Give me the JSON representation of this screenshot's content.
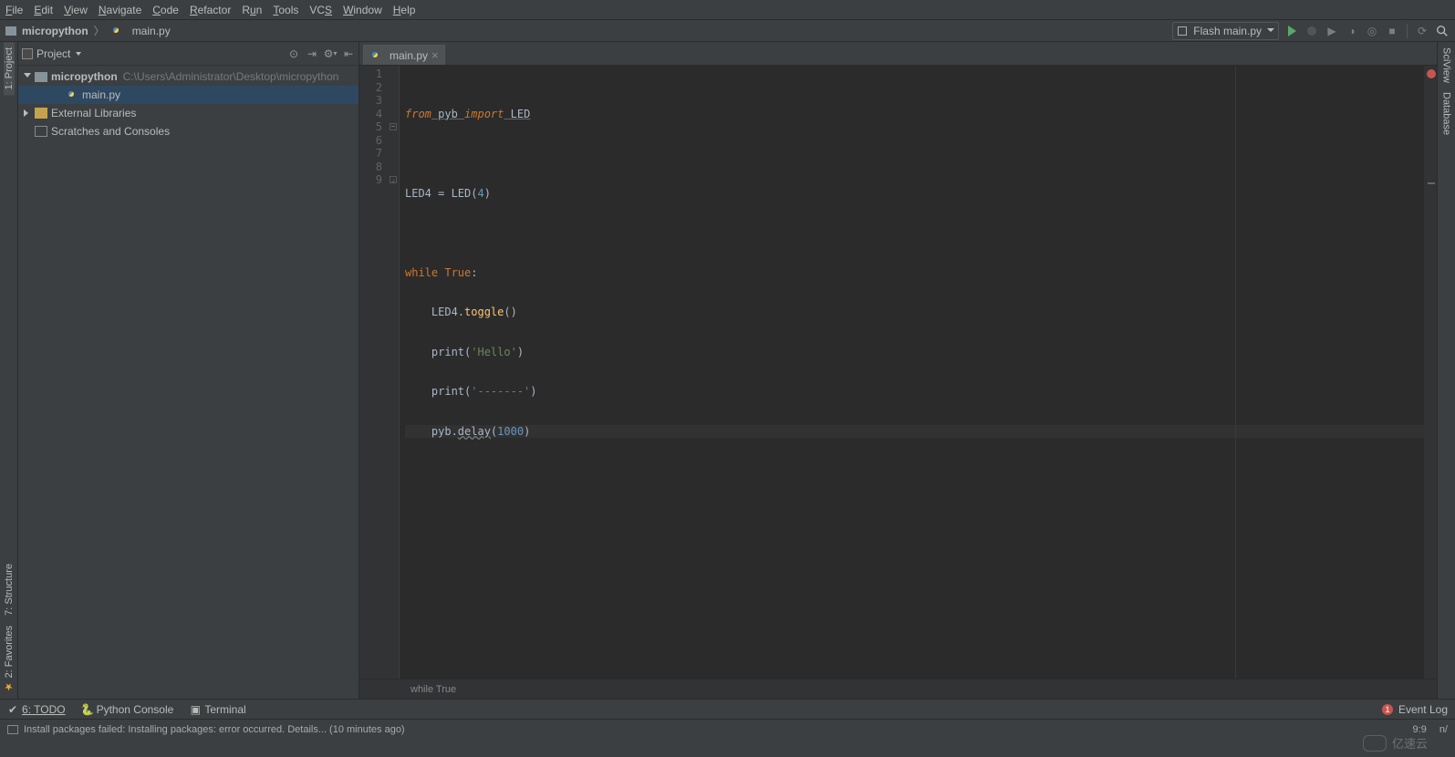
{
  "menu": [
    "File",
    "Edit",
    "View",
    "Navigate",
    "Code",
    "Refactor",
    "Run",
    "Tools",
    "VCS",
    "Window",
    "Help"
  ],
  "breadcrumb": {
    "project": "micropython",
    "file": "main.py"
  },
  "runConfig": "Flash main.py",
  "projectPanel": {
    "title": "Project",
    "tree": {
      "root": "micropython",
      "rootPath": "C:\\Users\\Administrator\\Desktop\\micropython",
      "file": "main.py",
      "extLib": "External Libraries",
      "scratch": "Scratches and Consoles"
    }
  },
  "leftTabs": {
    "project": "1: Project",
    "structure": "7: Structure",
    "favorites": "2: Favorites"
  },
  "rightTabs": {
    "sciview": "SciView",
    "database": "Database"
  },
  "editor": {
    "tab": "main.py",
    "lines": [
      1,
      2,
      3,
      4,
      5,
      6,
      7,
      8,
      9
    ],
    "code": {
      "l1_from": "from",
      "l1_pyb": " pyb ",
      "l1_import": "import",
      "l1_led": " LED",
      "l3_a": "LED4 ",
      "l3_b": "= LED(",
      "l3_n": "4",
      "l3_c": ")",
      "l5_a": "while ",
      "l5_b": "True",
      "l5_c": ":",
      "l6_a": "    LED4.",
      "l6_call": "toggle",
      "l6_b": "()",
      "l7_a": "    print(",
      "l7_s": "'Hello'",
      "l7_b": ")",
      "l8_a": "    print(",
      "l8_s": "'-------'",
      "l8_b": ")",
      "l9_a": "    pyb.",
      "l9_call": "delay",
      "l9_b": "(",
      "l9_n": "1000",
      "l9_c": ")"
    },
    "breadcrumb": "while True"
  },
  "bottomTabs": {
    "todo": "6: TODO",
    "pyconsole": "Python Console",
    "terminal": "Terminal",
    "eventlog": "Event Log",
    "eventWarnCount": "1"
  },
  "status": {
    "msg": "Install packages failed: Installing packages: error occurred. Details... (10 minutes ago)",
    "pos": "9:9",
    "mode": "n/"
  },
  "watermark": "亿速云"
}
